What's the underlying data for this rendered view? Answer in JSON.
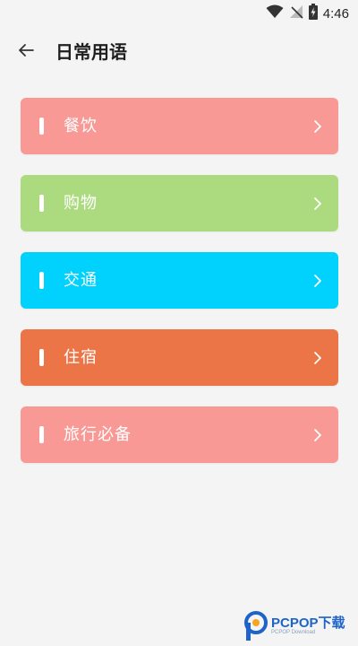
{
  "status_bar": {
    "time": "4:46",
    "icons": [
      "wifi-icon",
      "no-signal-icon",
      "battery-charging-icon"
    ]
  },
  "header": {
    "back_icon": "arrow-left-icon",
    "title": "日常用语"
  },
  "categories": [
    {
      "label": "餐饮",
      "color": "#f89995"
    },
    {
      "label": "购物",
      "color": "#acdb7f"
    },
    {
      "label": "交通",
      "color": "#00d1fd"
    },
    {
      "label": "住宿",
      "color": "#ec7548"
    },
    {
      "label": "旅行必备",
      "color": "#f89995"
    }
  ],
  "watermark": {
    "brand": "PCPOP下载",
    "sub": "PCPOP Download"
  }
}
